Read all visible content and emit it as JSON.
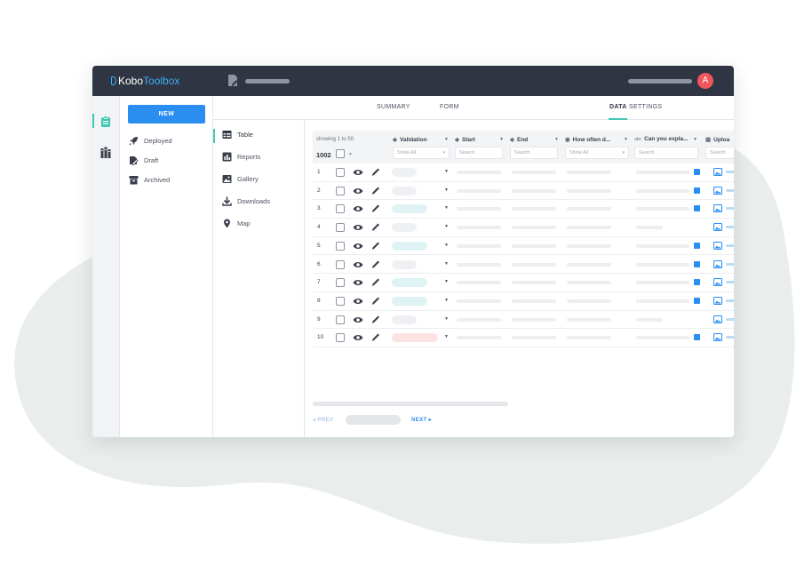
{
  "app": {
    "logo_part1": "Kobo",
    "logo_part2": "Toolbox",
    "avatar_initial": "A"
  },
  "drawer": {
    "new_label": "NEW",
    "items": [
      {
        "label": "Deployed",
        "icon": "rocket-icon"
      },
      {
        "label": "Draft",
        "icon": "draft-icon"
      },
      {
        "label": "Archived",
        "icon": "archive-icon"
      }
    ]
  },
  "tabs": [
    {
      "label": "SUMMARY",
      "active": false
    },
    {
      "label": "FORM",
      "active": false
    },
    {
      "label": "DATA",
      "active": true
    },
    {
      "label": "SETTINGS",
      "active": false
    }
  ],
  "subnav": [
    {
      "label": "Table",
      "icon": "table-icon",
      "active": true
    },
    {
      "label": "Reports",
      "icon": "reports-icon",
      "active": false
    },
    {
      "label": "Gallery",
      "icon": "gallery-icon",
      "active": false
    },
    {
      "label": "Downloads",
      "icon": "download-icon",
      "active": false
    },
    {
      "label": "Map",
      "icon": "map-pin-icon",
      "active": false
    }
  ],
  "table": {
    "showing": "showing 1 to 50",
    "count": "1002",
    "columns": [
      {
        "label": "Validation",
        "icon": "tag-icon",
        "filter": "Show All"
      },
      {
        "label": "Start",
        "icon": "tag-icon",
        "filter": "Search"
      },
      {
        "label": "End",
        "icon": "tag-icon",
        "filter": "Search"
      },
      {
        "label": "How often d...",
        "icon": "radio-icon",
        "filter": "Show All"
      },
      {
        "label": "Can you expla...",
        "icon": "text-icon",
        "filter": "Search"
      },
      {
        "label": "Uploa",
        "icon": "image-icon",
        "filter": "Search"
      }
    ],
    "rows": [
      "1",
      "2",
      "3",
      "4",
      "5",
      "6",
      "7",
      "8",
      "9",
      "10"
    ]
  },
  "pager": {
    "prev": "PREV",
    "next": "NEXT"
  },
  "colors": {
    "topbar": "#2f3542",
    "accent": "#3fc8b4",
    "primary": "#2a8ef0",
    "avatar": "#f0565d",
    "pill_grey": "#eef0f3",
    "pill_teal": "#dff3f5",
    "pill_red": "#fde2e4"
  }
}
